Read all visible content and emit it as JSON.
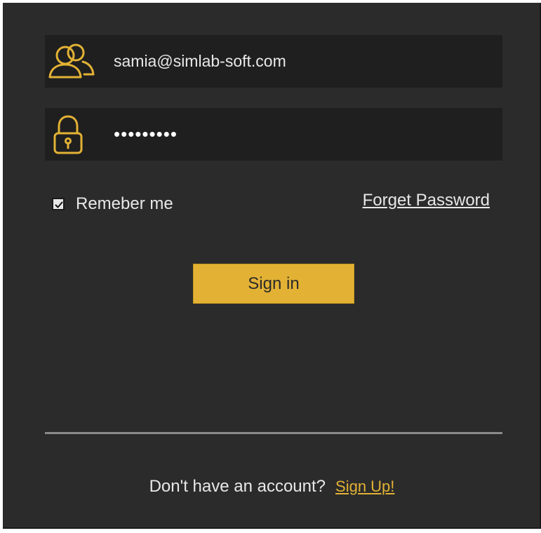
{
  "login": {
    "email_value": "samia@simlab-soft.com",
    "password_value": "•••••••••",
    "remember_label": "Remeber me",
    "remember_checked": true,
    "forgot_label": "Forget Password",
    "signin_label": "Sign in"
  },
  "footer": {
    "prompt": "Don't have an account?",
    "signup_label": "Sign Up!"
  },
  "icons": {
    "user": "users-icon",
    "password": "lock-icon",
    "check": "checkmark-icon"
  },
  "colors": {
    "background": "#2b2b2b",
    "field": "#1f1f1f",
    "accent": "#e3b235",
    "text": "#e8e8e8"
  }
}
